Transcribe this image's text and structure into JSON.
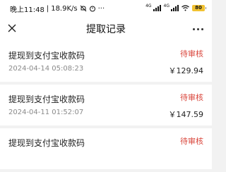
{
  "status_bar": {
    "time": "晚上11:48",
    "separator": "|",
    "speed": "18.9K/s",
    "net_tag_1": "4G",
    "net_tag_2": "4G",
    "battery": "80"
  },
  "header": {
    "title": "提取记录"
  },
  "records": [
    {
      "title": "提现到支付宝收款码",
      "status": "待审核",
      "time": "2024-04-14 05:08:23",
      "amount": "￥129.94"
    },
    {
      "title": "提现到支付宝收款码",
      "status": "待审核",
      "time": "2024-04-11 01:52:07",
      "amount": "￥147.59"
    },
    {
      "title": "提现到支付宝收款码",
      "status": "待审核",
      "time": "",
      "amount": ""
    }
  ],
  "colors": {
    "status_pending": "#d9453b",
    "battery": "#f1c232"
  }
}
